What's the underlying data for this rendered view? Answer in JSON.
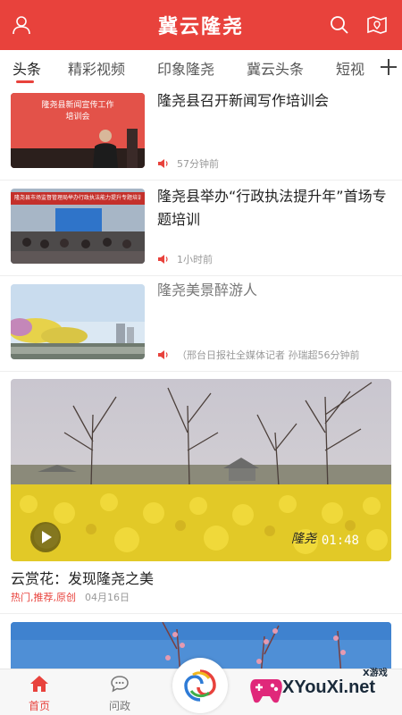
{
  "header": {
    "title": "冀云隆尧",
    "left_icon": "user-icon",
    "right_icons": [
      "search-icon",
      "map-book-icon"
    ],
    "bg_color": "#e8423c"
  },
  "tabs": {
    "items": [
      {
        "label": "头条",
        "active": true
      },
      {
        "label": "精彩视频"
      },
      {
        "label": "印象隆尧"
      },
      {
        "label": "冀云头条"
      },
      {
        "label": "短视"
      }
    ],
    "add_icon": "plus-icon"
  },
  "news": [
    {
      "title": "隆尧县召开新闻写作培训会",
      "meta": "57分钟前",
      "thumb_text_line1": "隆尧县新闻宣传工作",
      "thumb_text_line2": "培训会"
    },
    {
      "title": "隆尧县举办“行政执法提升年”首场专题培训",
      "meta": "1小时前",
      "thumb_banner": "隆尧县市场监督管理局举办行政执法能力提升专题培训班"
    },
    {
      "title": "隆尧美景醉游人",
      "meta": "（邢台日报社全媒体记者 孙瑞超56分钟前"
    }
  ],
  "video": {
    "title": "云赏花：发现隆尧之美",
    "duration": "01:48",
    "watermark": "隆尧",
    "tags": "热门,推荐,原创",
    "date": "04月16日"
  },
  "bottom_nav": {
    "items": [
      {
        "label": "首页",
        "icon": "home-icon",
        "active": true
      },
      {
        "label": "问政",
        "icon": "chat-icon"
      }
    ],
    "center_icon": "app-logo-icon"
  },
  "overlay": {
    "brand": "XYouXi.net",
    "small": "X游戏"
  },
  "colors": {
    "accent": "#e8423c",
    "muted": "#999999"
  }
}
